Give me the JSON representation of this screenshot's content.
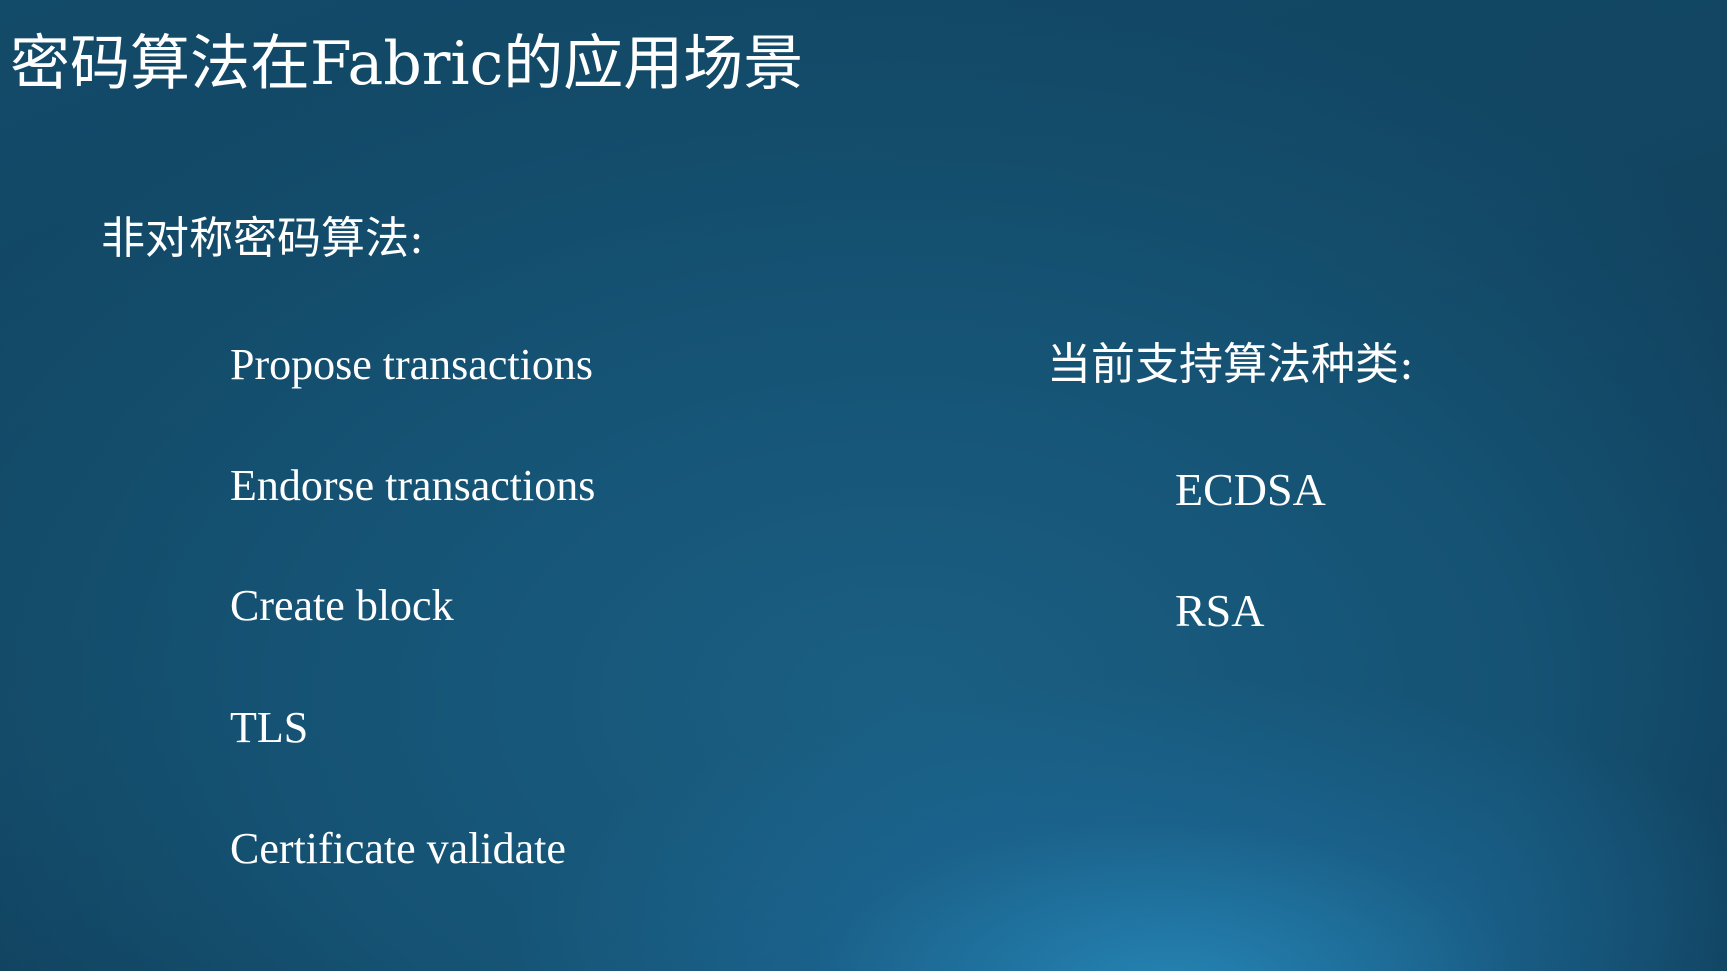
{
  "slide": {
    "title": "密码算法在Fabric的应用场景",
    "heading": "非对称密码算法:",
    "use_cases": [
      "Propose transactions",
      "Endorse transactions",
      "Create block",
      "TLS",
      "Certificate validate"
    ],
    "algorithms_heading": "当前支持算法种类:",
    "algorithms": [
      "ECDSA",
      "RSA"
    ]
  },
  "colors": {
    "background_dark": "#0e3550",
    "background_mid": "#155273",
    "background_glow": "#288cbe",
    "text": "#ffffff"
  }
}
